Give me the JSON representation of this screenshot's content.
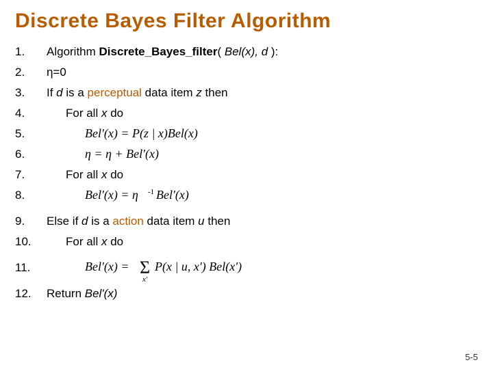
{
  "title": "Discrete Bayes Filter Algorithm",
  "lines": {
    "n1": "1.",
    "n2": "2.",
    "n3": "3.",
    "n4": "4.",
    "n5": "5.",
    "n6": "6.",
    "n7": "7.",
    "n8": "8.",
    "n9": "9.",
    "n10": "10.",
    "n11": "11.",
    "n12": "12."
  },
  "text": {
    "algo_word": "Algorithm ",
    "algo_name": "Discrete_Bayes_filter",
    "algo_args_open": "( ",
    "algo_arg1": "Bel(x), d",
    "algo_args_close": " ):",
    "eta_init": "η=0",
    "if_word": "If ",
    "d_var": "d",
    "is_a": " is a ",
    "perceptual": "perceptual",
    "data_item": " data item ",
    "z_var": "z",
    "then_word": " then",
    "for_all": "For all ",
    "x_var": "x",
    "do_word": " do",
    "else_if": "Else if ",
    "action": "action",
    "u_var": "u",
    "return_word": "Return ",
    "belprime": "Bel'(x)"
  },
  "equations": {
    "eq5": "Bel'(x) = P(z | x) Bel(x)",
    "eq6": "η = η + Bel'(x)",
    "eq8": "Bel'(x) = η⁻¹ Bel'(x)",
    "eq11": "Bel'(x) = Σ_{x'} P(x | u, x') Bel(x')"
  },
  "footer": "5-5"
}
